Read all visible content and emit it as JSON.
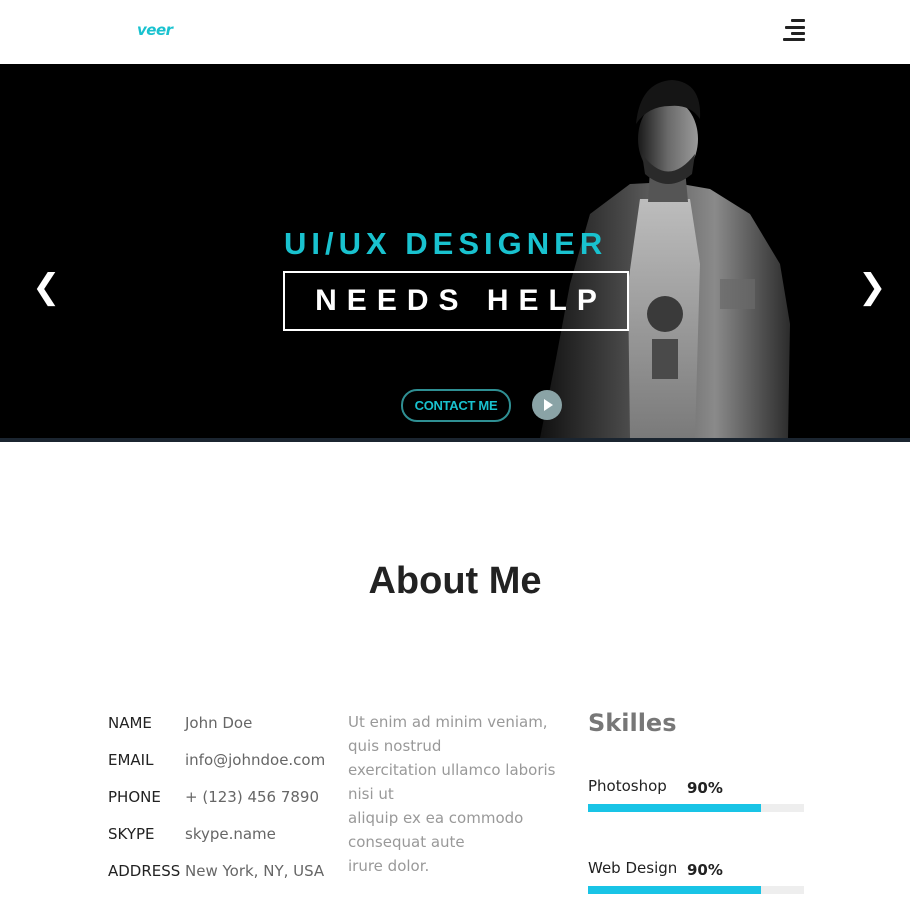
{
  "header": {
    "logo": "veer"
  },
  "hero": {
    "subtitle": "UI/UX DESIGNER",
    "title": "NEEDS HELP",
    "contact_button": "CONTACT ME",
    "prev_arrow": "❮",
    "next_arrow": "❯"
  },
  "about": {
    "title": "About Me",
    "info": [
      {
        "label": "NAME",
        "value": "John Doe"
      },
      {
        "label": "EMAIL",
        "value": "info@johndoe.com"
      },
      {
        "label": "PHONE",
        "value": "+ (123) 456 7890"
      },
      {
        "label": "SKYPE",
        "value": "skype.name"
      },
      {
        "label": "ADDRESS",
        "value": "New York, NY, USA"
      }
    ],
    "text_lines": [
      "Ut enim ad minim veniam,",
      "quis nostrud",
      "exercitation ullamco laboris",
      "nisi ut",
      "aliquip ex ea commodo",
      "consequat aute",
      "irure dolor."
    ],
    "skills_title": "Skilles",
    "skills": [
      {
        "name": "Photoshop",
        "percent_label": "90%",
        "level": 0.8
      },
      {
        "name": "Web Design",
        "percent_label": "90%",
        "level": 0.8
      }
    ]
  },
  "colors": {
    "accent": "#19c2cf",
    "skill_bar": "#19c4e6",
    "hero_bg": "#000000"
  }
}
